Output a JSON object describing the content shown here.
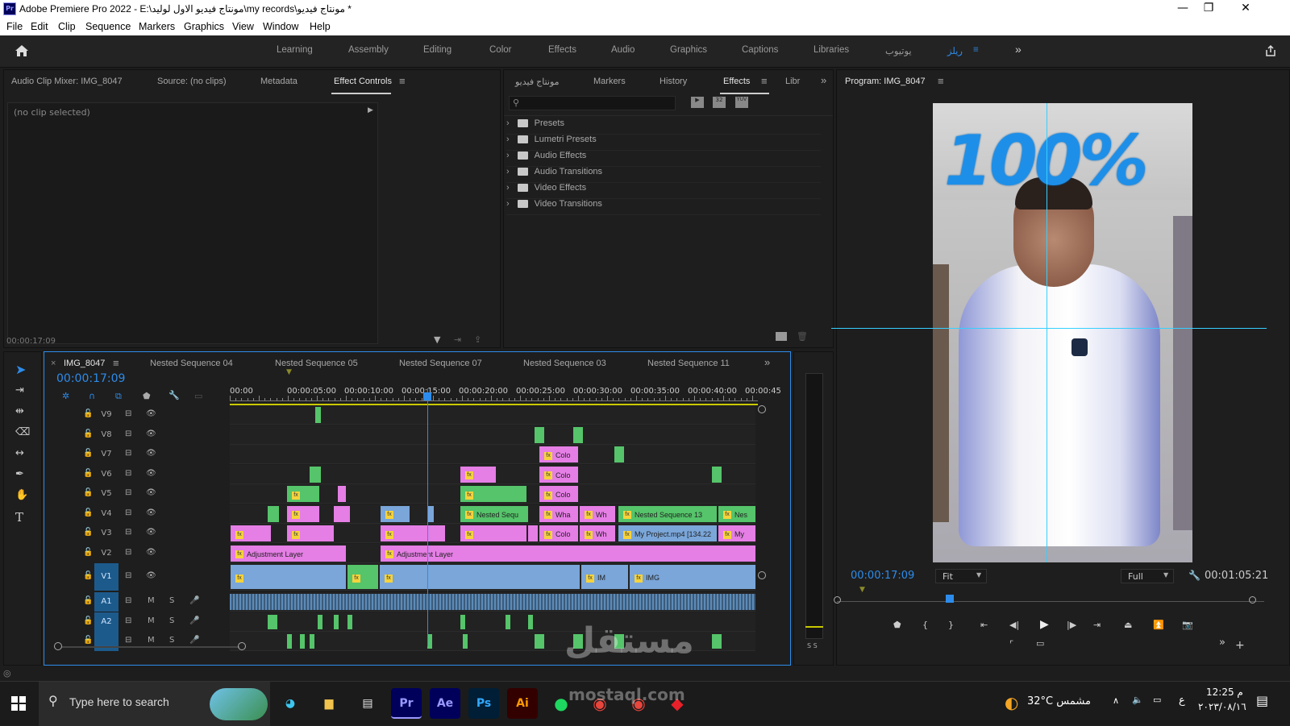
{
  "window": {
    "title": "Adobe Premiere Pro 2022 - E:\\مونتاج فيديو الاول لوليد\\my records\\مونتاج فيديو *",
    "app_icon": "Pr",
    "controls": [
      "—",
      "❐",
      "✕"
    ]
  },
  "menu": [
    "File",
    "Edit",
    "Clip",
    "Sequence",
    "Markers",
    "Graphics",
    "View",
    "Window",
    "Help"
  ],
  "workspaces": {
    "items": [
      "Learning",
      "Assembly",
      "Editing",
      "Color",
      "Effects",
      "Audio",
      "Graphics",
      "Captions",
      "Libraries",
      "يوتيوب",
      "ريلز"
    ],
    "active": "ريلز",
    "more": "»"
  },
  "source_panel": {
    "tabs": [
      "Audio Clip Mixer: IMG_8047",
      "Source: (no clips)",
      "Metadata",
      "Effect Controls"
    ],
    "active_tab": "Effect Controls",
    "no_clip_text": "(no clip selected)",
    "timecode": "00:00:17:09"
  },
  "effects_panel": {
    "tabs": [
      "مونتاج فيديو",
      "Markers",
      "History",
      "Effects",
      "Libr"
    ],
    "active_tab": "Effects",
    "search_placeholder": "",
    "tree": [
      "Presets",
      "Lumetri Presets",
      "Audio Effects",
      "Audio Transitions",
      "Video Effects",
      "Video Transitions"
    ]
  },
  "program_monitor": {
    "title": "Program: IMG_8047",
    "overlay_text": "100%",
    "timecode_current": "00:00:17:09",
    "timecode_duration": "00:01:05:21",
    "fit": "Fit",
    "quality": "Full",
    "playhead_fraction": 0.265
  },
  "timeline": {
    "tabs": [
      "IMG_8047",
      "Nested Sequence 04",
      "Nested Sequence 05",
      "Nested Sequence 07",
      "Nested Sequence 03",
      "Nested Sequence 11"
    ],
    "active_tab": "IMG_8047",
    "timecode": "00:00:17:09",
    "ruler": [
      "00:00",
      "00:00:05:00",
      "00:00:10:00",
      "00:00:15:00",
      "00:00:20:00",
      "00:00:25:00",
      "00:00:30:00",
      "00:00:35:00",
      "00:00:40:00",
      "00:00:45"
    ],
    "video_tracks": [
      "V9",
      "V8",
      "V7",
      "V6",
      "V5",
      "V4",
      "V3",
      "V2",
      "V1"
    ],
    "audio_tracks": [
      "A1",
      "A2",
      ""
    ],
    "clip_labels": {
      "colo": "Colo",
      "nested_sequ": "Nested Sequ",
      "wha": "Wha",
      "wh": "Wh",
      "nested13": "Nested Sequence 13",
      "nes": "Nes",
      "my_project": "My Project.mp4 [134.22",
      "my": "My",
      "adjustment": "Adjustment Layer",
      "im": "IM",
      "img": "IMG"
    },
    "m": "M",
    "s": "S",
    "meter_ss": "S S"
  },
  "taskbar": {
    "search_placeholder": "Type here to search",
    "apps": [
      "Pr",
      "Ae",
      "Ps",
      "Ai"
    ],
    "weather": "32°C مشمس",
    "time": "12:25 م",
    "date": "٢٠٢٣/٠٨/١٦",
    "lang": "ع"
  },
  "watermark": {
    "main": "مستقل",
    "sub": "mostaql.com"
  },
  "colors": {
    "accent": "#2d8ceb",
    "clip_pink": "#e57ee5",
    "clip_blue": "#7aa6d9",
    "clip_green": "#55c46a"
  }
}
